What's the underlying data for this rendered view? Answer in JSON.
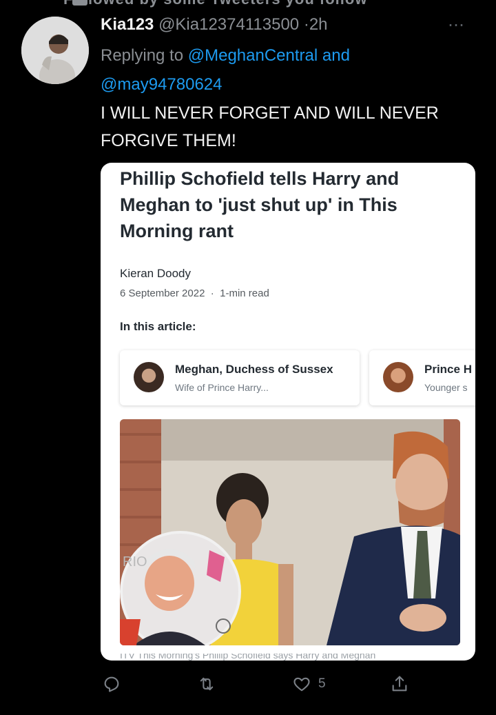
{
  "context": {
    "text": "Followed by some Tweeters you follow"
  },
  "tweet": {
    "display_name": "Kia123",
    "handle": "@Kia12374113500",
    "separator": "·",
    "time": "2h",
    "more_icon": "⋯",
    "reply_prefix": "Replying to",
    "reply_mention_1": "@MeghanCentral",
    "reply_and": "and",
    "reply_mention_2": "@may94780624",
    "text": "I WILL NEVER FORGET AND WILL NEVER FORGIVE THEM!"
  },
  "card": {
    "title": "Phillip Schofield tells Harry and Meghan to 'just shut up' in This Morning rant",
    "author": "Kieran Doody",
    "date": "6 September 2022",
    "meta_separator": "·",
    "read_time": "1-min read",
    "in_article_label": "In this article:",
    "entities": [
      {
        "name": "Meghan, Duchess of Sussex",
        "desc": "Wife of Prince Harry..."
      },
      {
        "name": "Prince H",
        "desc": "Younger s"
      }
    ],
    "photo_badge_text": "RIO",
    "caption_peek": "ITV This Morning's Phillip Schofield says Harry and Meghan"
  },
  "actions": {
    "reply_icon": "reply-icon",
    "retweet_icon": "retweet-icon",
    "like_icon": "heart-icon",
    "like_count": "5",
    "share_icon": "share-icon"
  },
  "colors": {
    "background": "#000000",
    "accent": "#1d9bf0",
    "secondary_text": "#8b8f94",
    "primary_text": "#f2f2f2"
  }
}
